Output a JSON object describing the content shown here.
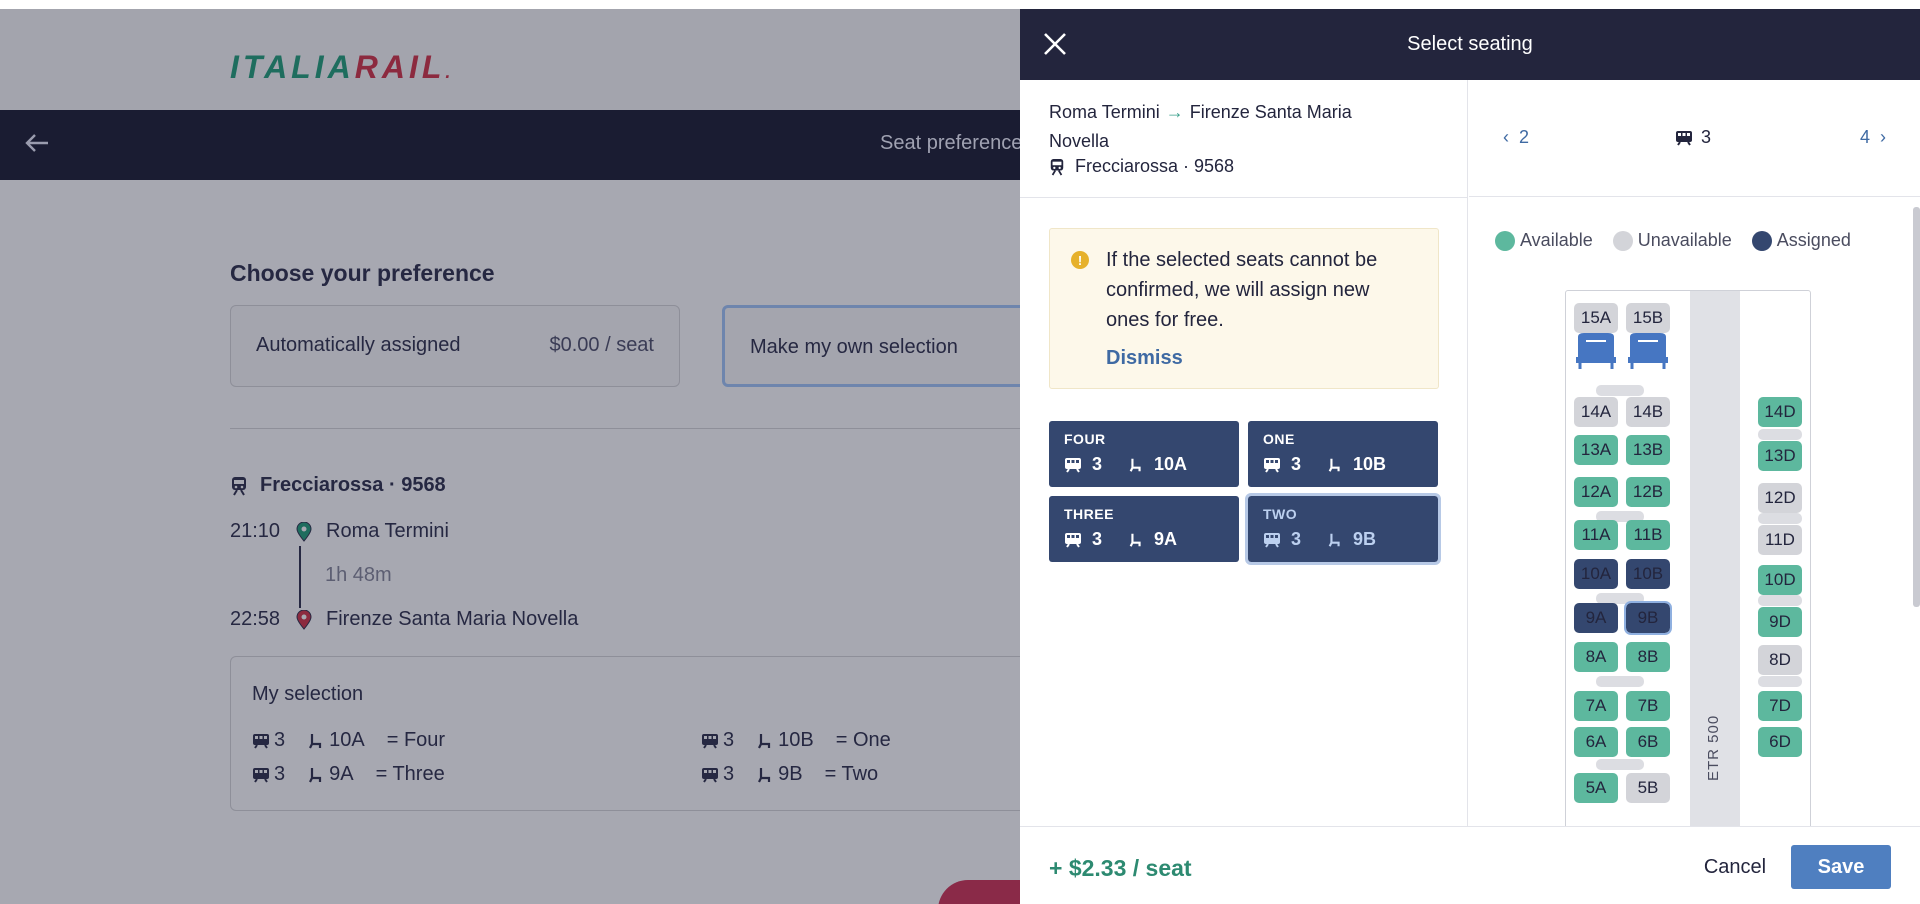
{
  "brand": {
    "logo_part1": "ITALIA",
    "logo_part2": "RAIL",
    "logo_dot": "."
  },
  "nav": {
    "title": "Seat preference"
  },
  "preference": {
    "title": "Choose your preference",
    "auto_label": "Automatically assigned",
    "auto_price": "$0.00 / seat",
    "own_label": "Make my own selection"
  },
  "trip": {
    "train": "Frecciarossa · 9568",
    "dep_time": "21:10",
    "dep_station": "Roma Termini",
    "duration": "1h 48m",
    "arr_time": "22:58",
    "arr_station": "Firenze Santa Maria Novella"
  },
  "my_selection": {
    "title": "My selection",
    "items": [
      {
        "car": "3",
        "seat": "10A",
        "name": "= Four"
      },
      {
        "car": "3",
        "seat": "10B",
        "name": "= One"
      },
      {
        "car": "3",
        "seat": "9A",
        "name": "= Three"
      },
      {
        "car": "3",
        "seat": "9B",
        "name": "= Two"
      }
    ]
  },
  "drawer": {
    "title": "Select seating",
    "route_from": "Roma Termini",
    "route_to": "Firenze Santa Maria Novella",
    "train": "Frecciarossa · 9568",
    "notice": "If the selected seats cannot be confirmed, we will assign new ones for free.",
    "dismiss": "Dismiss",
    "passengers": [
      {
        "name": "FOUR",
        "car": "3",
        "seat": "10A"
      },
      {
        "name": "ONE",
        "car": "3",
        "seat": "10B"
      },
      {
        "name": "THREE",
        "car": "3",
        "seat": "9A"
      },
      {
        "name": "TWO",
        "car": "3",
        "seat": "9B"
      }
    ],
    "car_prev": "2",
    "car_current": "3",
    "car_next": "4",
    "legend": {
      "available": "Available",
      "unavailable": "Unavailable",
      "assigned": "Assigned"
    },
    "coach_label": "ETR 500",
    "price": "+ $2.33 / seat",
    "cancel": "Cancel",
    "save": "Save"
  },
  "seats": {
    "s15A": "15A",
    "s15B": "15B",
    "s14A": "14A",
    "s14B": "14B",
    "s14D": "14D",
    "s13A": "13A",
    "s13B": "13B",
    "s13D": "13D",
    "s12A": "12A",
    "s12B": "12B",
    "s12D": "12D",
    "s11A": "11A",
    "s11B": "11B",
    "s11D": "11D",
    "s10A": "10A",
    "s10B": "10B",
    "s10D": "10D",
    "s9A": "9A",
    "s9B": "9B",
    "s9D": "9D",
    "s8A": "8A",
    "s8B": "8B",
    "s8D": "8D",
    "s7A": "7A",
    "s7B": "7B",
    "s7D": "7D",
    "s6A": "6A",
    "s6B": "6B",
    "s6D": "6D",
    "s5A": "5A",
    "s5B": "5B"
  },
  "colors": {
    "header": "#23253d",
    "available": "#5db89e",
    "unavailable": "#d3d4d9",
    "assigned": "#34476f",
    "save": "#4f7fc0",
    "price": "#2d8a71"
  }
}
